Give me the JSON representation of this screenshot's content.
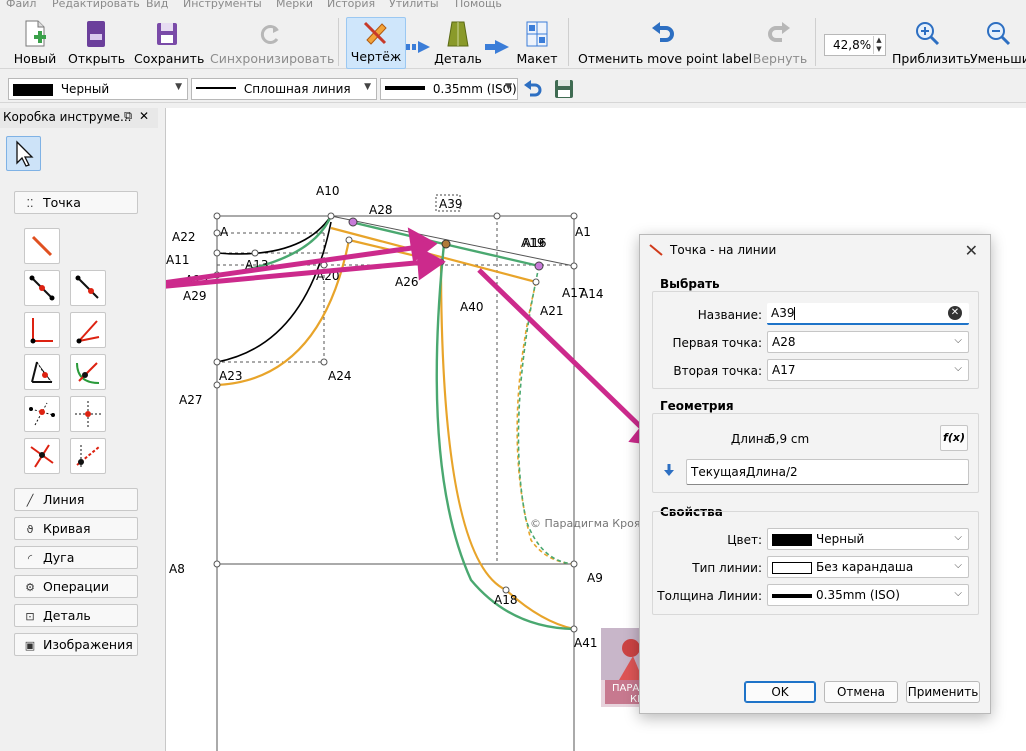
{
  "menu": [
    "Файл",
    "Редактировать",
    "Вид",
    "Инструменты",
    "Мерки",
    "История",
    "Утилиты",
    "Помощь"
  ],
  "toolbar": {
    "new": "Новый",
    "open": "Открыть",
    "save": "Сохранить",
    "sync": "Синхронизировать",
    "draw": "Чертёж",
    "detail": "Деталь",
    "layout": "Макет",
    "undo": "Отменить move point label",
    "redo": "Вернуть",
    "zoom_value": "42,8%",
    "zoom_in": "Приблизить",
    "zoom_out": "Уменьши"
  },
  "toolbar2": {
    "color": "Черный",
    "line_type": "Сплошная линия",
    "line_weight": "0.35mm (ISO)"
  },
  "toolbox": {
    "title": "Коробка инструме...",
    "groups": {
      "point": "Точка",
      "line": "Линия",
      "curve": "Кривая",
      "arc": "Дуга",
      "operations": "Операции",
      "detail": "Деталь",
      "images": "Изображения"
    }
  },
  "canvas": {
    "labels": [
      "A10",
      "A28",
      "A39",
      "A19",
      "A16",
      "A1",
      "A22",
      "A",
      "A11",
      "A13",
      "A15",
      "A29",
      "A20",
      "A26",
      "A40",
      "A17",
      "A14",
      "A21",
      "A23",
      "A24",
      "A27",
      "A8",
      "A9",
      "A18",
      "A41"
    ],
    "watermark": "© Парадигма Кроя",
    "logo_text": "ПАРАДИГМА КРОЯ"
  },
  "dialog": {
    "title": "Точка - на линии",
    "select": {
      "heading": "Выбрать",
      "name_label": "Название:",
      "name_value": "A39",
      "first_point_label": "Первая точка:",
      "first_point_value": "A28",
      "second_point_label": "Вторая точка:",
      "second_point_value": "A17"
    },
    "geometry": {
      "heading": "Геометрия",
      "length_label": "Длина:",
      "length_value": "5,9 cm",
      "formula": "ТекущаяДлина/2",
      "fx": "f(x)"
    },
    "properties": {
      "heading": "Свойства",
      "color_label": "Цвет:",
      "color_value": "Черный",
      "line_type_label": "Тип линии:",
      "line_type_value": "Без карандаша",
      "weight_label": "Толщина Линии:",
      "weight_value": "0.35mm (ISO)"
    },
    "buttons": {
      "ok": "OK",
      "cancel": "Отмена",
      "apply": "Применить"
    }
  },
  "colors": {
    "accent": "#3b7dd8",
    "arrow": "#cc2a8c",
    "green_line": "#4aa870",
    "orange_line": "#e8a42a",
    "active_button": "#cfe6fb"
  }
}
